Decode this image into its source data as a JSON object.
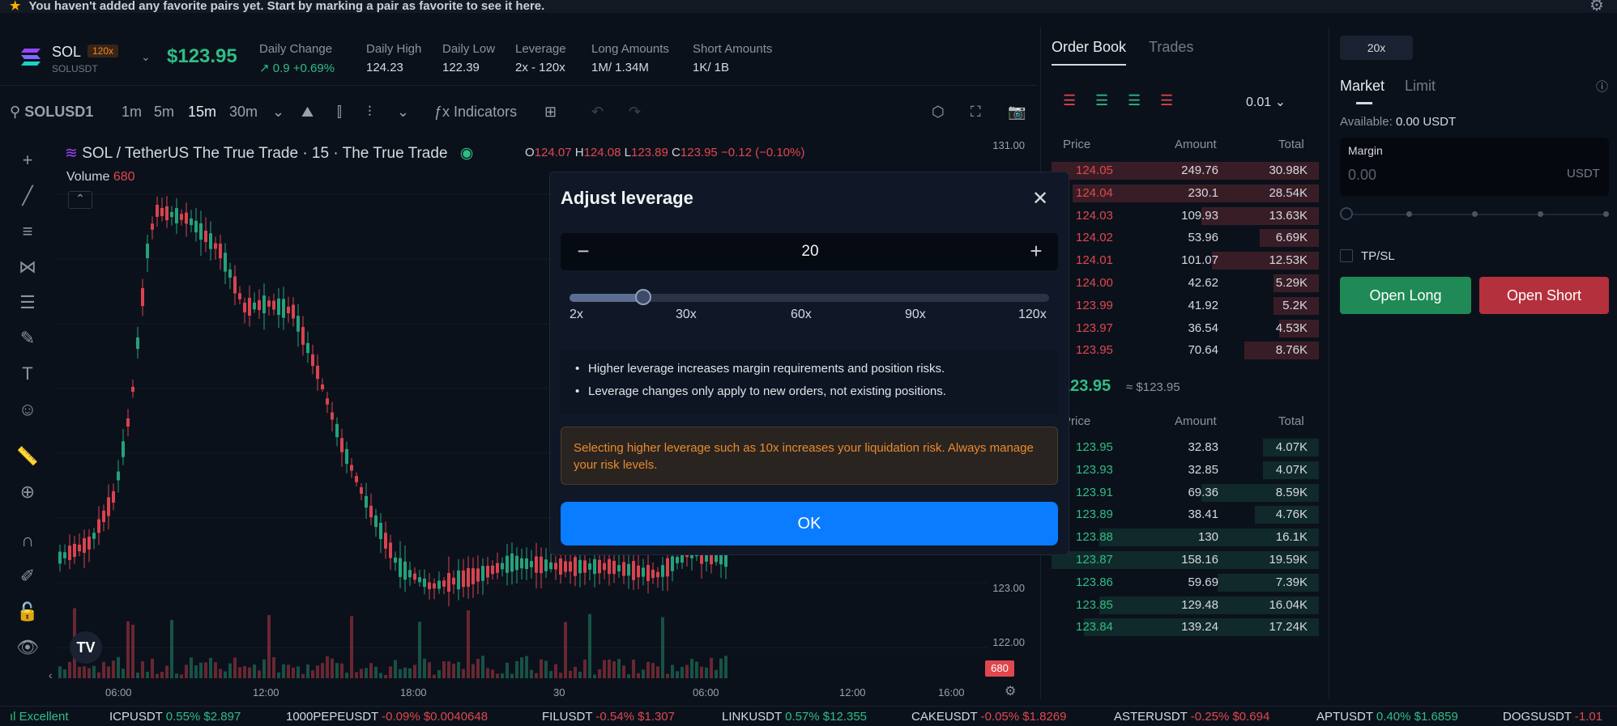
{
  "banner": {
    "text": "You haven't added any favorite pairs yet. Start by marking a pair as favorite to see it here."
  },
  "ticker": {
    "symbol": "SOL",
    "leverage_badge": "120x",
    "pair": "SOLUSDT",
    "price": "$123.95",
    "stats": [
      {
        "label": "Daily Change",
        "value": "0.9 +0.69%"
      },
      {
        "label": "Daily High",
        "value": "124.23"
      },
      {
        "label": "Daily Low",
        "value": "122.39"
      },
      {
        "label": "Leverage",
        "value": "2x - 120x"
      },
      {
        "label": "Long Amounts",
        "value": "1M/ 1.34M"
      },
      {
        "label": "Short Amounts",
        "value": "1K/ 1B"
      }
    ]
  },
  "toolbar": {
    "search": "SOLUSD1",
    "intervals": [
      "1m",
      "5m",
      "15m",
      "30m"
    ],
    "indicators": "Indicators"
  },
  "chart": {
    "title": "SOL / TetherUS The True Trade · 15 · The True Trade",
    "ohlc": {
      "o_label": "O",
      "o": "124.07",
      "h_label": "H",
      "h": "124.08",
      "l_label": "L",
      "l": "123.89",
      "c_label": "C",
      "c": "123.95",
      "change": "−0.12 (−0.10%)"
    },
    "volume_label": "Volume",
    "volume_value": "680",
    "y_ticks": [
      "131.00",
      "123.00",
      "122.00"
    ],
    "vol_tag": "680",
    "x_ticks": [
      "06:00",
      "12:00",
      "18:00",
      "30",
      "06:00",
      "12:00",
      "16:00"
    ]
  },
  "orderbook": {
    "tabs": [
      "Order Book",
      "Trades"
    ],
    "precision": "0.01",
    "headers": [
      "Price",
      "Amount",
      "Total"
    ],
    "asks": [
      [
        "124.05",
        "249.76",
        "30.98K"
      ],
      [
        "124.04",
        "230.1",
        "28.54K"
      ],
      [
        "124.03",
        "109.93",
        "13.63K"
      ],
      [
        "124.02",
        "53.96",
        "6.69K"
      ],
      [
        "124.01",
        "101.07",
        "12.53K"
      ],
      [
        "124.00",
        "42.62",
        "5.29K"
      ],
      [
        "123.99",
        "41.92",
        "5.2K"
      ],
      [
        "123.97",
        "36.54",
        "4.53K"
      ],
      [
        "123.95",
        "70.64",
        "8.76K"
      ]
    ],
    "ask_depth": [
      1.0,
      0.92,
      0.44,
      0.22,
      0.4,
      0.17,
      0.17,
      0.15,
      0.28
    ],
    "mid_price": "123.95",
    "mid_usd": "≈ $123.95",
    "bids": [
      [
        "123.95",
        "32.83",
        "4.07K"
      ],
      [
        "123.93",
        "32.85",
        "4.07K"
      ],
      [
        "123.91",
        "69.36",
        "8.59K"
      ],
      [
        "123.89",
        "38.41",
        "4.76K"
      ],
      [
        "123.88",
        "130",
        "16.1K"
      ],
      [
        "123.87",
        "158.16",
        "19.59K"
      ],
      [
        "123.86",
        "59.69",
        "7.39K"
      ],
      [
        "123.85",
        "129.48",
        "16.04K"
      ],
      [
        "123.84",
        "139.24",
        "17.24K"
      ]
    ],
    "bid_depth": [
      0.21,
      0.21,
      0.44,
      0.24,
      0.82,
      1.0,
      0.38,
      0.82,
      0.88
    ]
  },
  "trade": {
    "leverage_chip": "20x",
    "tabs": [
      "Market",
      "Limit"
    ],
    "available_label": "Available:",
    "available_value": "0.00 USDT",
    "margin_label": "Margin",
    "margin_placeholder": "0.00",
    "margin_unit": "USDT",
    "tpsl": "TP/SL",
    "open_long": "Open Long",
    "open_short": "Open Short"
  },
  "bottom": {
    "status": "Excellent",
    "items": [
      {
        "sym": "ICPUSDT",
        "chg": "0.55%",
        "px": "$2.897",
        "up": true
      },
      {
        "sym": "1000PEPEUSDT",
        "chg": "-0.09%",
        "px": "$0.0040648",
        "up": false
      },
      {
        "sym": "FILUSDT",
        "chg": "-0.54%",
        "px": "$1.307",
        "up": false
      },
      {
        "sym": "LINKUSDT",
        "chg": "0.57%",
        "px": "$12.355",
        "up": true
      },
      {
        "sym": "CAKEUSDT",
        "chg": "-0.05%",
        "px": "$1.8269",
        "up": false
      },
      {
        "sym": "ASTERUSDT",
        "chg": "-0.25%",
        "px": "$0.694",
        "up": false
      },
      {
        "sym": "APTUSDT",
        "chg": "0.40%",
        "px": "$1.6859",
        "up": true
      },
      {
        "sym": "DOGSUSDT",
        "chg": "-1.01",
        "px": "",
        "up": false
      }
    ]
  },
  "modal": {
    "title": "Adjust leverage",
    "value": "20",
    "slider_fraction": 0.154,
    "slider_labels": [
      "2x",
      "30x",
      "60x",
      "90x",
      "120x"
    ],
    "notes": [
      "Higher leverage increases margin requirements and position risks.",
      "Leverage changes only apply to new orders, not existing positions."
    ],
    "warning": "Selecting higher leverage such as 10x increases your liquidation risk. Always manage your risk levels.",
    "ok": "OK"
  },
  "colors": {
    "up": "#2fbd85",
    "down": "#e0474e",
    "accent": "#0a7cff",
    "warn": "#e88a2e"
  }
}
